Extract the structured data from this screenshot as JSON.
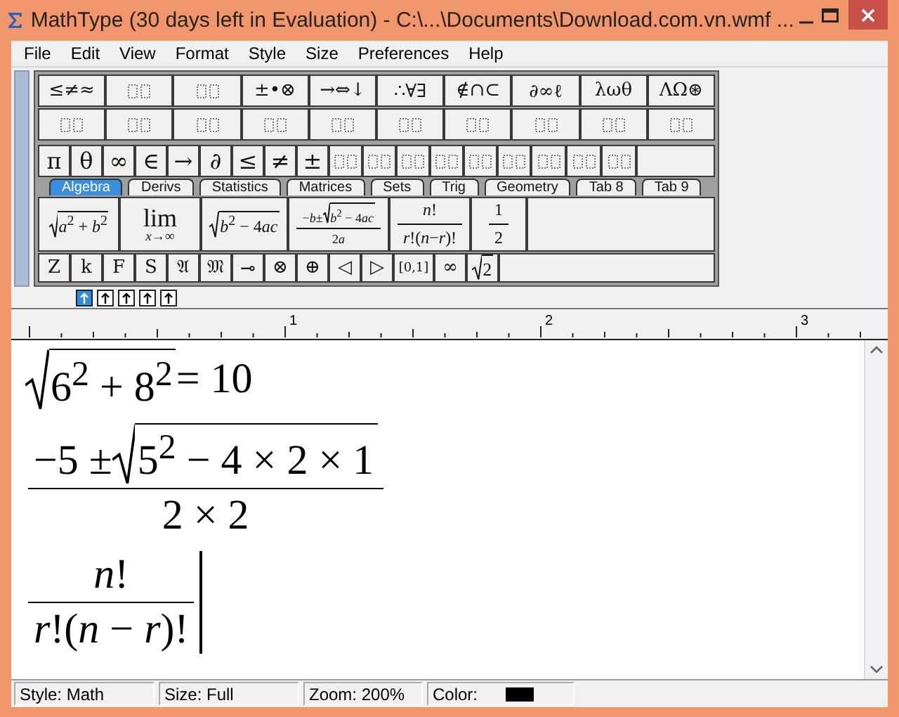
{
  "window": {
    "title": "MathType (30 days left in Evaluation) - C:\\...\\Documents\\Download.com.vn.wmf ..."
  },
  "menu": [
    "File",
    "Edit",
    "View",
    "Format",
    "Style",
    "Size",
    "Preferences",
    "Help"
  ],
  "palette": {
    "symbol_groups_row": [
      {
        "kind": "text",
        "label": "≤≠≈"
      },
      {
        "kind": "template"
      },
      {
        "kind": "template"
      },
      {
        "kind": "text",
        "label": "±•⊗"
      },
      {
        "kind": "text",
        "label": "→⇔↓"
      },
      {
        "kind": "text",
        "label": "∴∀∃"
      },
      {
        "kind": "text",
        "label": "∉∩⊂"
      },
      {
        "kind": "text",
        "label": "∂∞ℓ"
      },
      {
        "kind": "text",
        "label": "λωθ"
      },
      {
        "kind": "text",
        "label": "ΛΩ⊛"
      }
    ],
    "template_groups_row": [
      {
        "kind": "template"
      },
      {
        "kind": "template"
      },
      {
        "kind": "template"
      },
      {
        "kind": "template"
      },
      {
        "kind": "template"
      },
      {
        "kind": "template"
      },
      {
        "kind": "template"
      },
      {
        "kind": "template"
      },
      {
        "kind": "template"
      },
      {
        "kind": "template"
      }
    ],
    "small_items_row": [
      {
        "kind": "text",
        "label": "π"
      },
      {
        "kind": "text",
        "label": "θ"
      },
      {
        "kind": "text",
        "label": "∞"
      },
      {
        "kind": "text",
        "label": "∈"
      },
      {
        "kind": "text",
        "label": "→"
      },
      {
        "kind": "text",
        "label": "∂"
      },
      {
        "kind": "text",
        "label": "≤"
      },
      {
        "kind": "text",
        "label": "≠"
      },
      {
        "kind": "text",
        "label": "±"
      },
      {
        "kind": "template"
      },
      {
        "kind": "template"
      },
      {
        "kind": "template"
      },
      {
        "kind": "template"
      },
      {
        "kind": "template"
      },
      {
        "kind": "template"
      },
      {
        "kind": "template"
      },
      {
        "kind": "template"
      },
      {
        "kind": "template"
      }
    ],
    "tabs": [
      {
        "label": "Algebra",
        "selected": true
      },
      {
        "label": "Derivs",
        "selected": false
      },
      {
        "label": "Statistics",
        "selected": false
      },
      {
        "label": "Matrices",
        "selected": false
      },
      {
        "label": "Sets",
        "selected": false
      },
      {
        "label": "Trig",
        "selected": false
      },
      {
        "label": "Geometry",
        "selected": false
      },
      {
        "label": "Tab 8",
        "selected": false
      },
      {
        "label": "Tab 9",
        "selected": false
      }
    ],
    "expressions": [
      {
        "kind": "math",
        "expr": [
          {
            "kind": "sqrt",
            "body": [
              "*a*$^{2}$ + *b*$^{2}$"
            ]
          }
        ]
      },
      {
        "kind": "math",
        "expr": [
          {
            "kind": "under",
            "top": "lim",
            "bottom": "*x*→∞"
          }
        ]
      },
      {
        "kind": "math",
        "expr": [
          {
            "kind": "sqrt",
            "body": [
              "*b*$^{2}$ − 4",
              "*ac*"
            ]
          }
        ]
      },
      {
        "kind": "math",
        "expr": [
          {
            "kind": "frac",
            "num": [
              "−*b*±",
              {
                "kind": "sqrt",
                "body": [
                  "*b*$^{2}$ − 4",
                  "*ac*"
                ]
              }
            ],
            "den": [
              "2",
              "*a*"
            ]
          }
        ]
      },
      {
        "kind": "math",
        "expr": [
          {
            "kind": "frac",
            "num": [
              "*n*!"
            ],
            "den": [
              "*r*!(*n*−*r*)!"
            ]
          }
        ]
      },
      {
        "kind": "math",
        "expr": [
          {
            "kind": "frac",
            "num": [
              "1"
            ],
            "den": [
              "2"
            ]
          }
        ]
      }
    ],
    "symbols": [
      {
        "kind": "text",
        "label": "Z"
      },
      {
        "kind": "text",
        "label": "k"
      },
      {
        "kind": "text",
        "label": "F"
      },
      {
        "kind": "text",
        "label": "S"
      },
      {
        "kind": "text",
        "label": "𝔄"
      },
      {
        "kind": "text",
        "label": "𝔐"
      },
      {
        "kind": "text",
        "label": "⊸"
      },
      {
        "kind": "text",
        "label": "⊗"
      },
      {
        "kind": "text",
        "label": "⊕"
      },
      {
        "kind": "text",
        "label": "◁"
      },
      {
        "kind": "text",
        "label": "▷"
      },
      {
        "kind": "text",
        "label": "[0,1]"
      },
      {
        "kind": "text",
        "label": "∞"
      },
      {
        "kind": "math",
        "expr": [
          {
            "kind": "sqrt",
            "body": [
              "2"
            ]
          }
        ]
      }
    ]
  },
  "nudge_buttons": [
    {
      "selected": true
    },
    {
      "selected": false
    },
    {
      "selected": false
    },
    {
      "selected": false
    },
    {
      "selected": false
    }
  ],
  "ruler": {
    "labels": [
      "1",
      "2",
      "3"
    ]
  },
  "equations": [
    {
      "expr": [
        {
          "kind": "sqrt",
          "body": [
            "6$^{2}$ + 8$^{2}$"
          ]
        },
        " = 10"
      ],
      "cursor": false
    },
    {
      "expr": [
        {
          "kind": "frac",
          "num": [
            "−5 ± ",
            {
              "kind": "sqrt",
              "body": [
                "5$^{2}$ − 4 × 2 × 1"
              ]
            }
          ],
          "den": [
            "2 × 2"
          ]
        }
      ],
      "cursor": false
    },
    {
      "expr": [
        {
          "kind": "frac",
          "num": [
            "*n*!"
          ],
          "den": [
            "*r*!(*n* − *r*)!"
          ]
        }
      ],
      "cursor": true
    }
  ],
  "status_bar": [
    {
      "text": "Style: Math"
    },
    {
      "text": "Size: Full"
    },
    {
      "text": "Zoom: 200%"
    },
    {
      "text": "Color:",
      "color": "#000000"
    }
  ]
}
